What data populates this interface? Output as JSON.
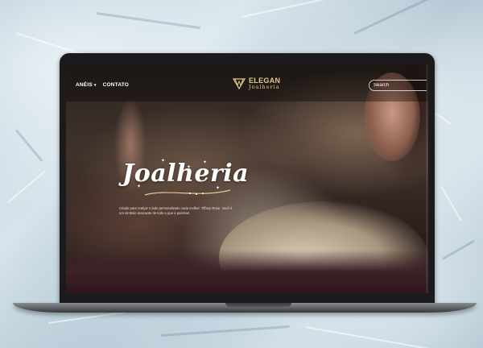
{
  "site": {
    "nav": [
      {
        "label": "ANÉIS",
        "has_dropdown": true
      },
      {
        "label": "CONTATO",
        "has_dropdown": false
      }
    ],
    "logo": {
      "brand": "ELEGAN",
      "subtitle": "Joalheria"
    },
    "search": {
      "placeholder": "Search"
    },
    "hero": {
      "title": "Joalheria",
      "text": "Criado para realçar o lado personalizado cada mulher. Tiffany Rose. Você é um símbolo marcante de todo o que é possível."
    }
  },
  "colors": {
    "accent_gold": "#e2c98c",
    "header_overlay": "#000000",
    "text": "#ffffff"
  },
  "icons": {
    "logo_mark": "geometric-w-icon",
    "nav_dropdown": "chevron-down-icon"
  }
}
